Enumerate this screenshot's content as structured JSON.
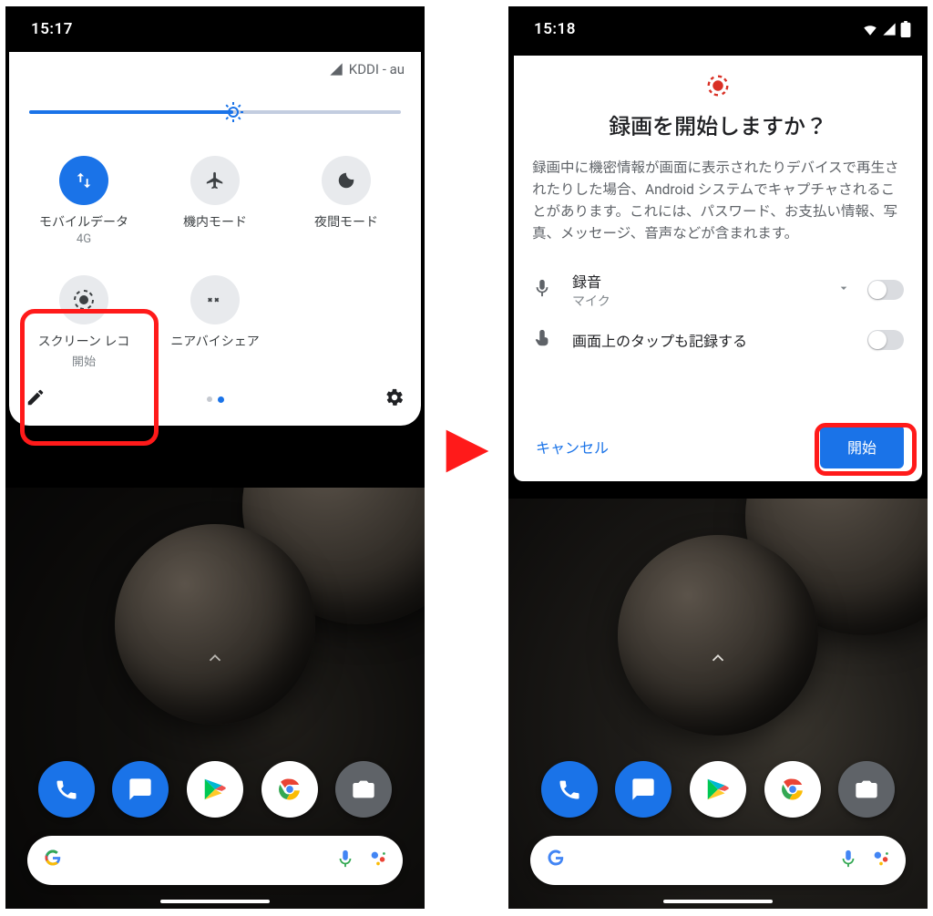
{
  "left": {
    "time": "15:17",
    "carrier": "KDDI - au",
    "tiles": [
      {
        "label": "モバイルデータ",
        "sub": "4G",
        "icon": "arrows-up-down",
        "active": true
      },
      {
        "label": "機内モード",
        "sub": "",
        "icon": "airplane",
        "active": false
      },
      {
        "label": "夜間モード",
        "sub": "",
        "icon": "moon",
        "active": false
      },
      {
        "label": "スクリーン レコ",
        "sub": "開始",
        "icon": "record-target",
        "active": false
      },
      {
        "label": "ニアバイシェア",
        "sub": "",
        "icon": "nearby-share",
        "active": false
      }
    ]
  },
  "right": {
    "time": "15:18",
    "dialog": {
      "title": "録画を開始しますか？",
      "body": "録画中に機密情報が画面に表示されたりデバイスで再生されたりした場合、Android システムでキャプチャされることがあります。これには、パスワード、お支払い情報、写真、メッセージ、音声などが含まれます。",
      "audio_label": "録音",
      "audio_sub": "マイク",
      "taps_label": "画面上のタップも記録する",
      "cancel": "キャンセル",
      "start": "開始"
    }
  },
  "colors": {
    "accent": "#1a73e8",
    "highlight": "#ff1a1a",
    "record": "#d93025"
  }
}
